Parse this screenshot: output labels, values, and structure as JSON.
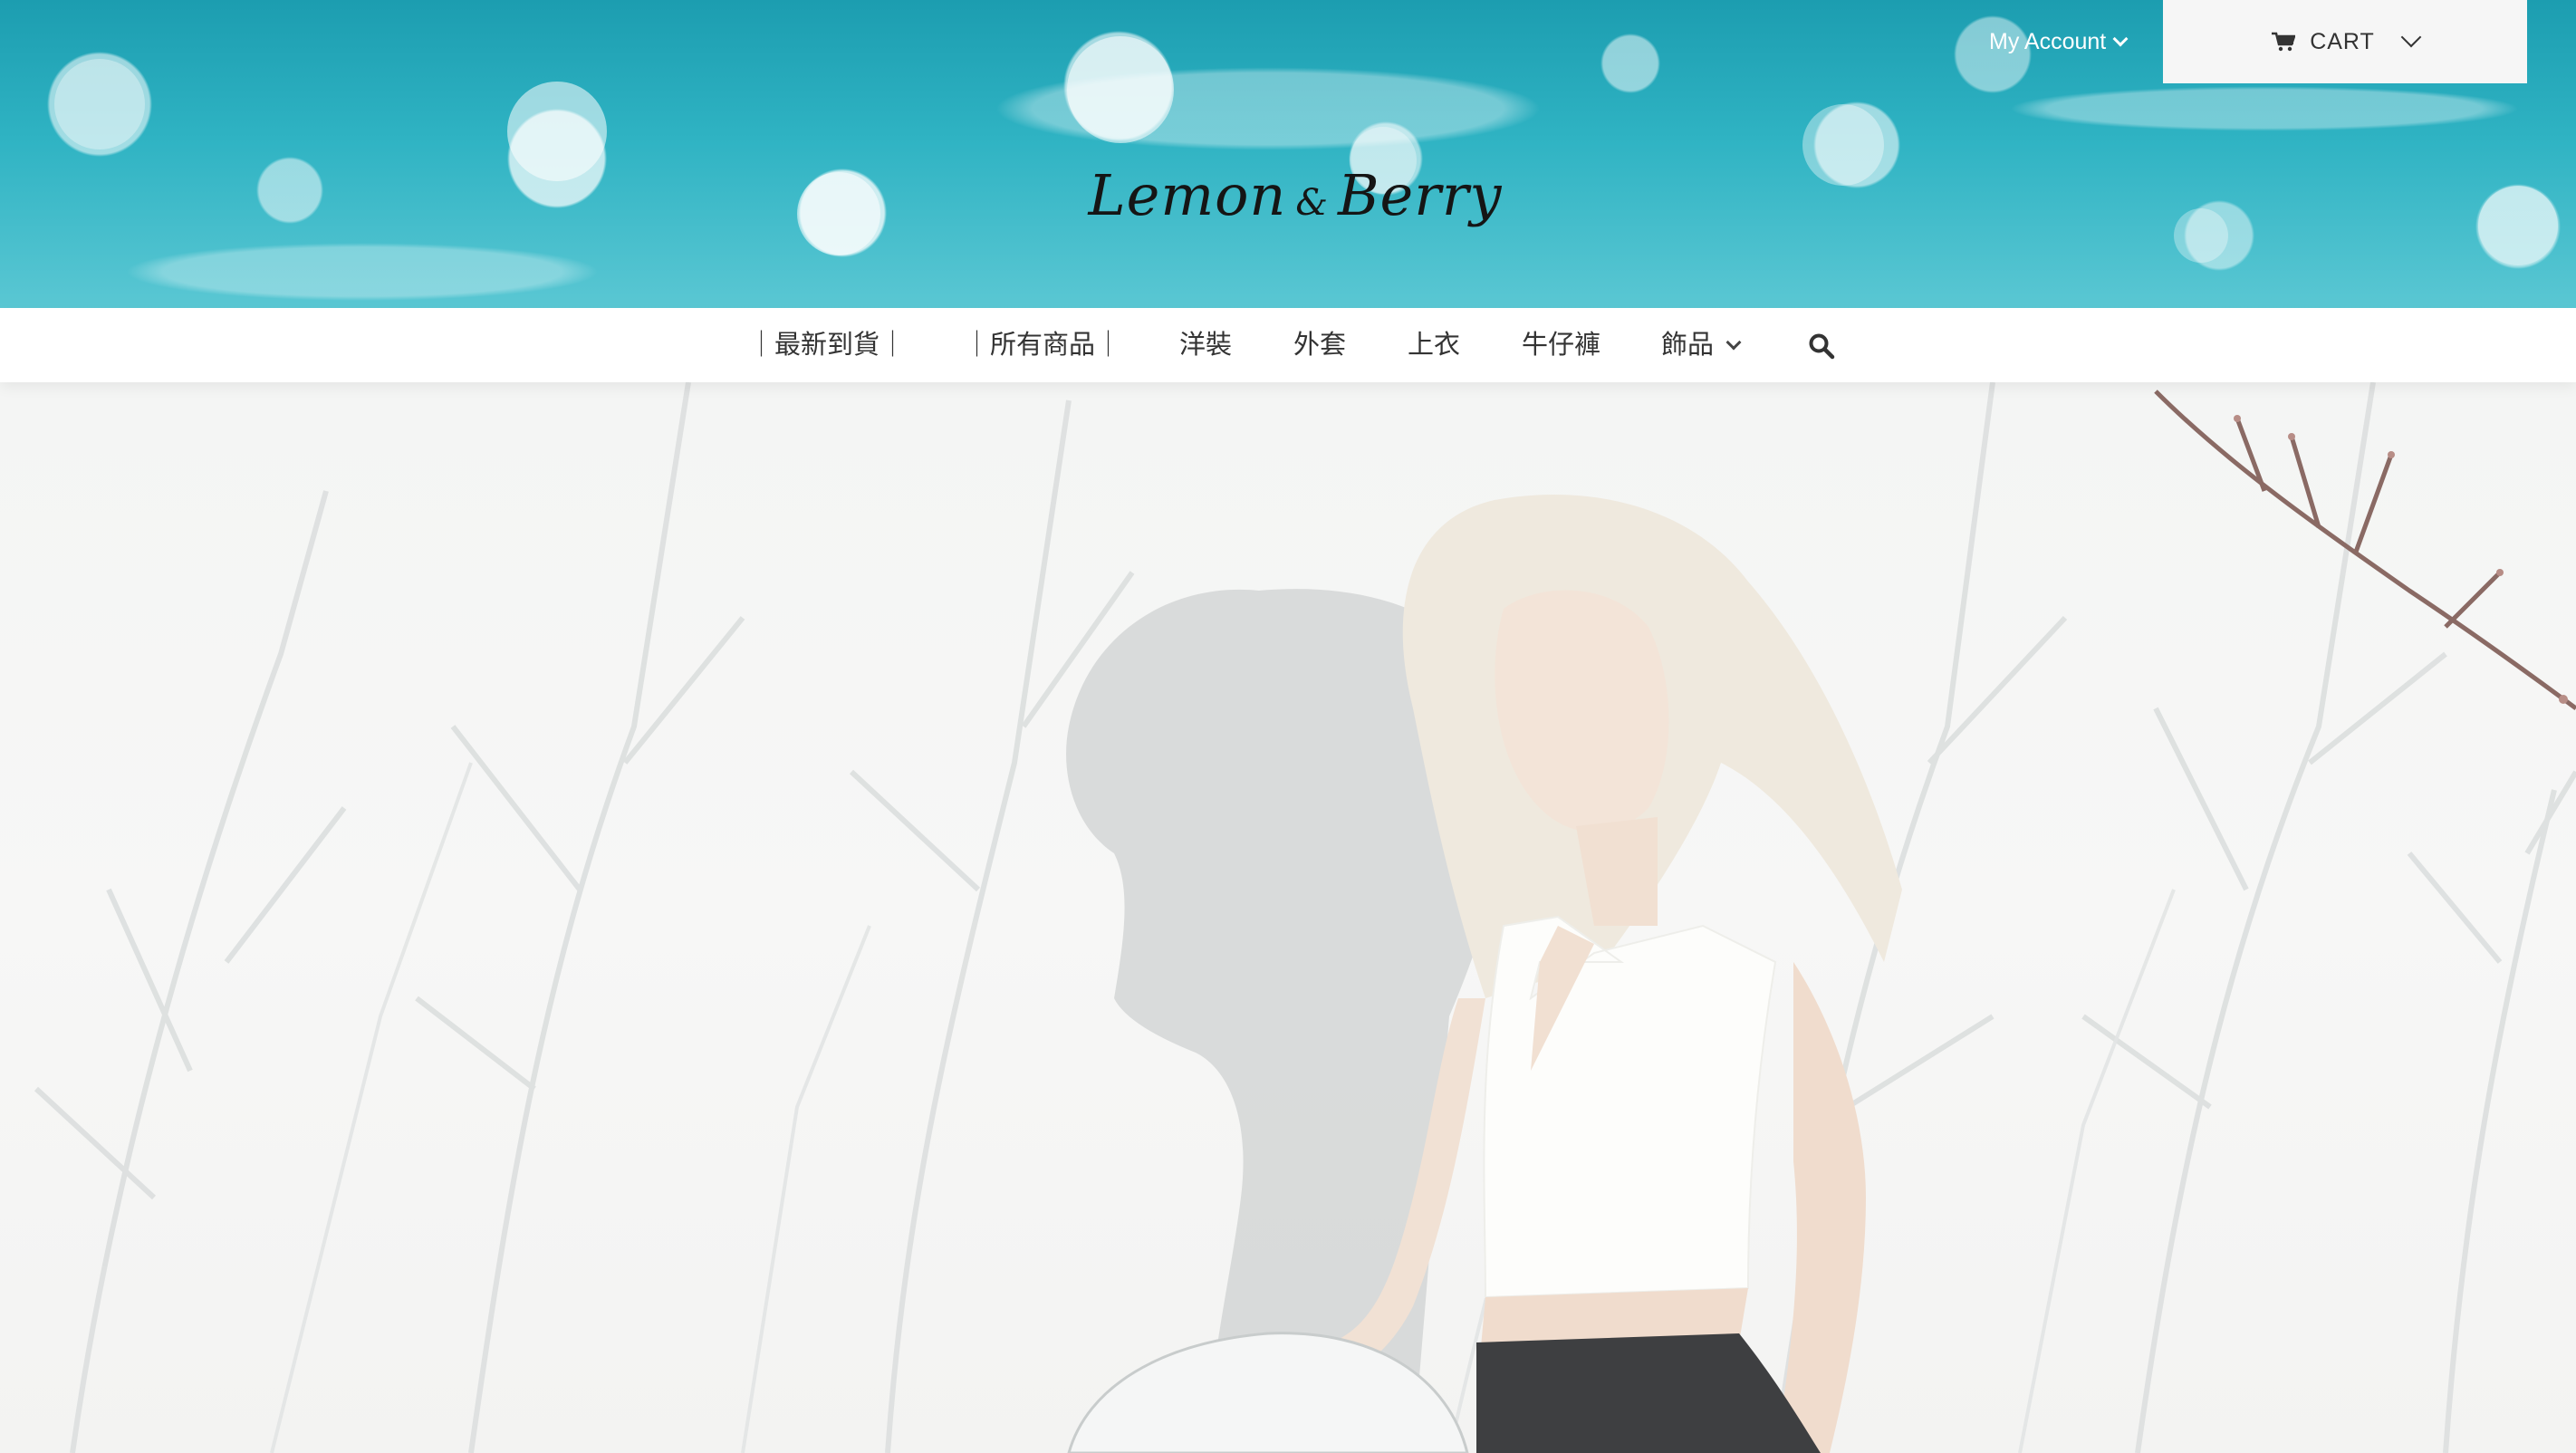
{
  "header": {
    "logo_text": "Lemon",
    "logo_amp": "&",
    "logo_text2": "Berry",
    "my_account_label": "My Account",
    "cart_label": "CART"
  },
  "nav": {
    "items": [
      {
        "label": "｜最新到貨｜"
      },
      {
        "label": "｜所有商品｜"
      },
      {
        "label": "洋裝"
      },
      {
        "label": "外套"
      },
      {
        "label": "上衣"
      },
      {
        "label": "牛仔褲"
      },
      {
        "label": "飾品"
      }
    ]
  },
  "icons": {
    "cart": "cart-icon",
    "search": "search-icon",
    "chevron": "chevron-down-icon"
  },
  "colors": {
    "banner_teal": "#2fb3c3",
    "nav_text": "#333333",
    "cart_bg": "#f6f6f6"
  }
}
